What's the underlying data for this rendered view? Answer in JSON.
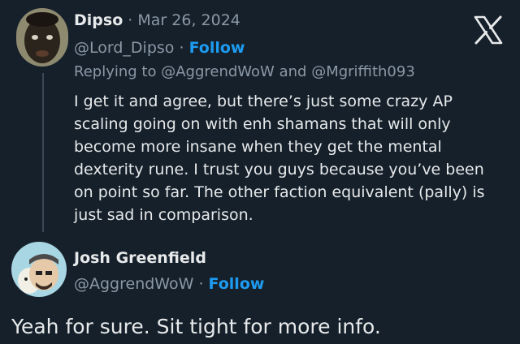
{
  "tweet": {
    "author_name": "Dipso",
    "date": "Mar 26, 2024",
    "handle": "@Lord_Dipso",
    "follow_label": "Follow",
    "reply_prefix": "Replying to",
    "reply_to_1": "@AggrendWoW",
    "reply_and": "and",
    "reply_to_2": "@Mgriffith093",
    "body_lines": [
      "I get it and agree, but there’s just some crazy AP",
      "scaling going on with enh shamans that will only",
      "become more insane when they get the mental",
      "dexterity rune. I trust you guys because you’ve been",
      "on point so far. The other faction equivalent (pally) is",
      "just sad in comparison."
    ]
  },
  "reply": {
    "author_name": "Josh Greenfield",
    "handle": "@AggrendWoW",
    "follow_label": "Follow",
    "text": "Yeah for sure. Sit tight for more info."
  },
  "separator": "·",
  "logo_icon": "x-logo-icon",
  "colors": {
    "background": "#15202b",
    "text": "#e7e9ea",
    "muted": "#8b98a5",
    "accent": "#1d9bf0"
  }
}
